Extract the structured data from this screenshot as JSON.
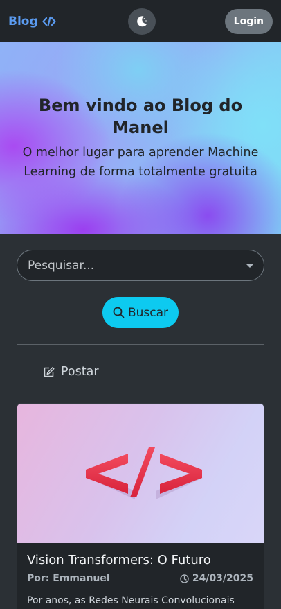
{
  "navbar": {
    "brand": "Blog",
    "brand_icon": "code-icon",
    "theme_icon": "moon-icon",
    "login_label": "Login"
  },
  "hero": {
    "title": "Bem vindo ao Blog do Manel",
    "subtitle": "O melhor lugar para aprender Machine Learning de forma totalmente gratuita"
  },
  "search": {
    "placeholder": "Pesquisar...",
    "button_label": "Buscar",
    "button_icon": "search-icon"
  },
  "post_link": {
    "label": "Postar",
    "icon": "edit-icon"
  },
  "posts": [
    {
      "title": "Vision Transformers: O Futuro",
      "author": "Por: Emmanuel",
      "date": "24/03/2025",
      "excerpt": "Por anos, as Redes Neurais Convolucionais",
      "image_icon": "code-symbol-icon"
    }
  ],
  "colors": {
    "navbar_bg": "#212529",
    "page_bg": "#2b3035",
    "brand": "#5b9bf0",
    "search_button": "#0dcaf0",
    "login_button": "#6c757d"
  }
}
